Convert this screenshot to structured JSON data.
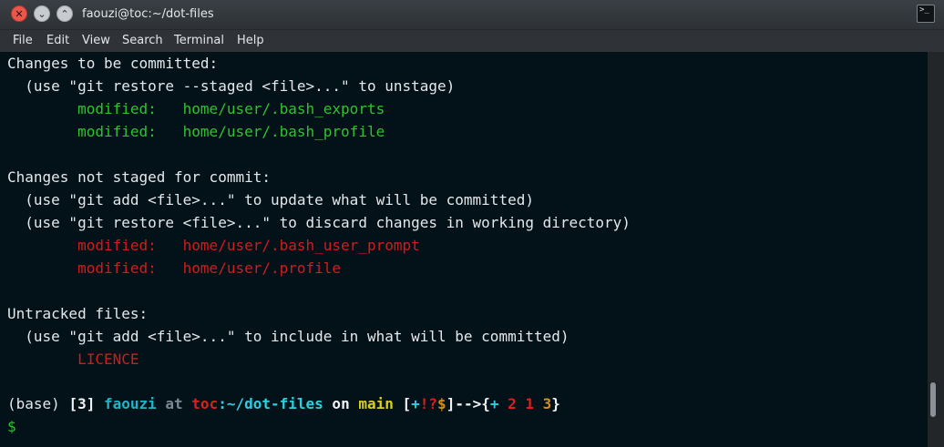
{
  "window": {
    "title": "faouzi@toc:~/dot-files",
    "close_glyph": "✕",
    "min_glyph": "⌄",
    "max_glyph": "⌃",
    "terminal_icon_glyph": ">_"
  },
  "menu": [
    "File",
    "Edit",
    "View",
    "Search",
    "Terminal",
    "Help"
  ],
  "colors": {
    "background": "#031218",
    "staged": "#2fc22f",
    "unstaged": "#d11c1c"
  },
  "terminal": {
    "staged_header": "Changes to be committed:",
    "staged_hint": "  (use \"git restore --staged <file>...\" to unstage)",
    "staged_files": [
      "        modified:   home/user/.bash_exports",
      "        modified:   home/user/.bash_profile"
    ],
    "unstaged_header": "Changes not staged for commit:",
    "unstaged_hint_1": "  (use \"git add <file>...\" to update what will be committed)",
    "unstaged_hint_2": "  (use \"git restore <file>...\" to discard changes in working directory)",
    "unstaged_files": [
      "        modified:   home/user/.bash_user_prompt",
      "        modified:   home/user/.profile"
    ],
    "untracked_header": "Untracked files:",
    "untracked_hint": "  (use \"git add <file>...\" to include in what will be committed)",
    "untracked_files": [
      "        LICENCE"
    ],
    "prompt": {
      "env": "(base) ",
      "jobs": "[3] ",
      "user": "faouzi",
      "at": " at ",
      "host": "toc",
      "path": ":~/dot-files",
      "on": " on ",
      "branch": "main",
      "status_open": " [",
      "status_plus": "+",
      "status_bang": "!",
      "status_q": "?",
      "status_dollar": "$",
      "status_close": "]-->{",
      "counts_plus": "+",
      "count_1": " 2",
      "count_2": " 1",
      "count_3": " 3",
      "counts_close": "}",
      "symbol": "$"
    }
  }
}
